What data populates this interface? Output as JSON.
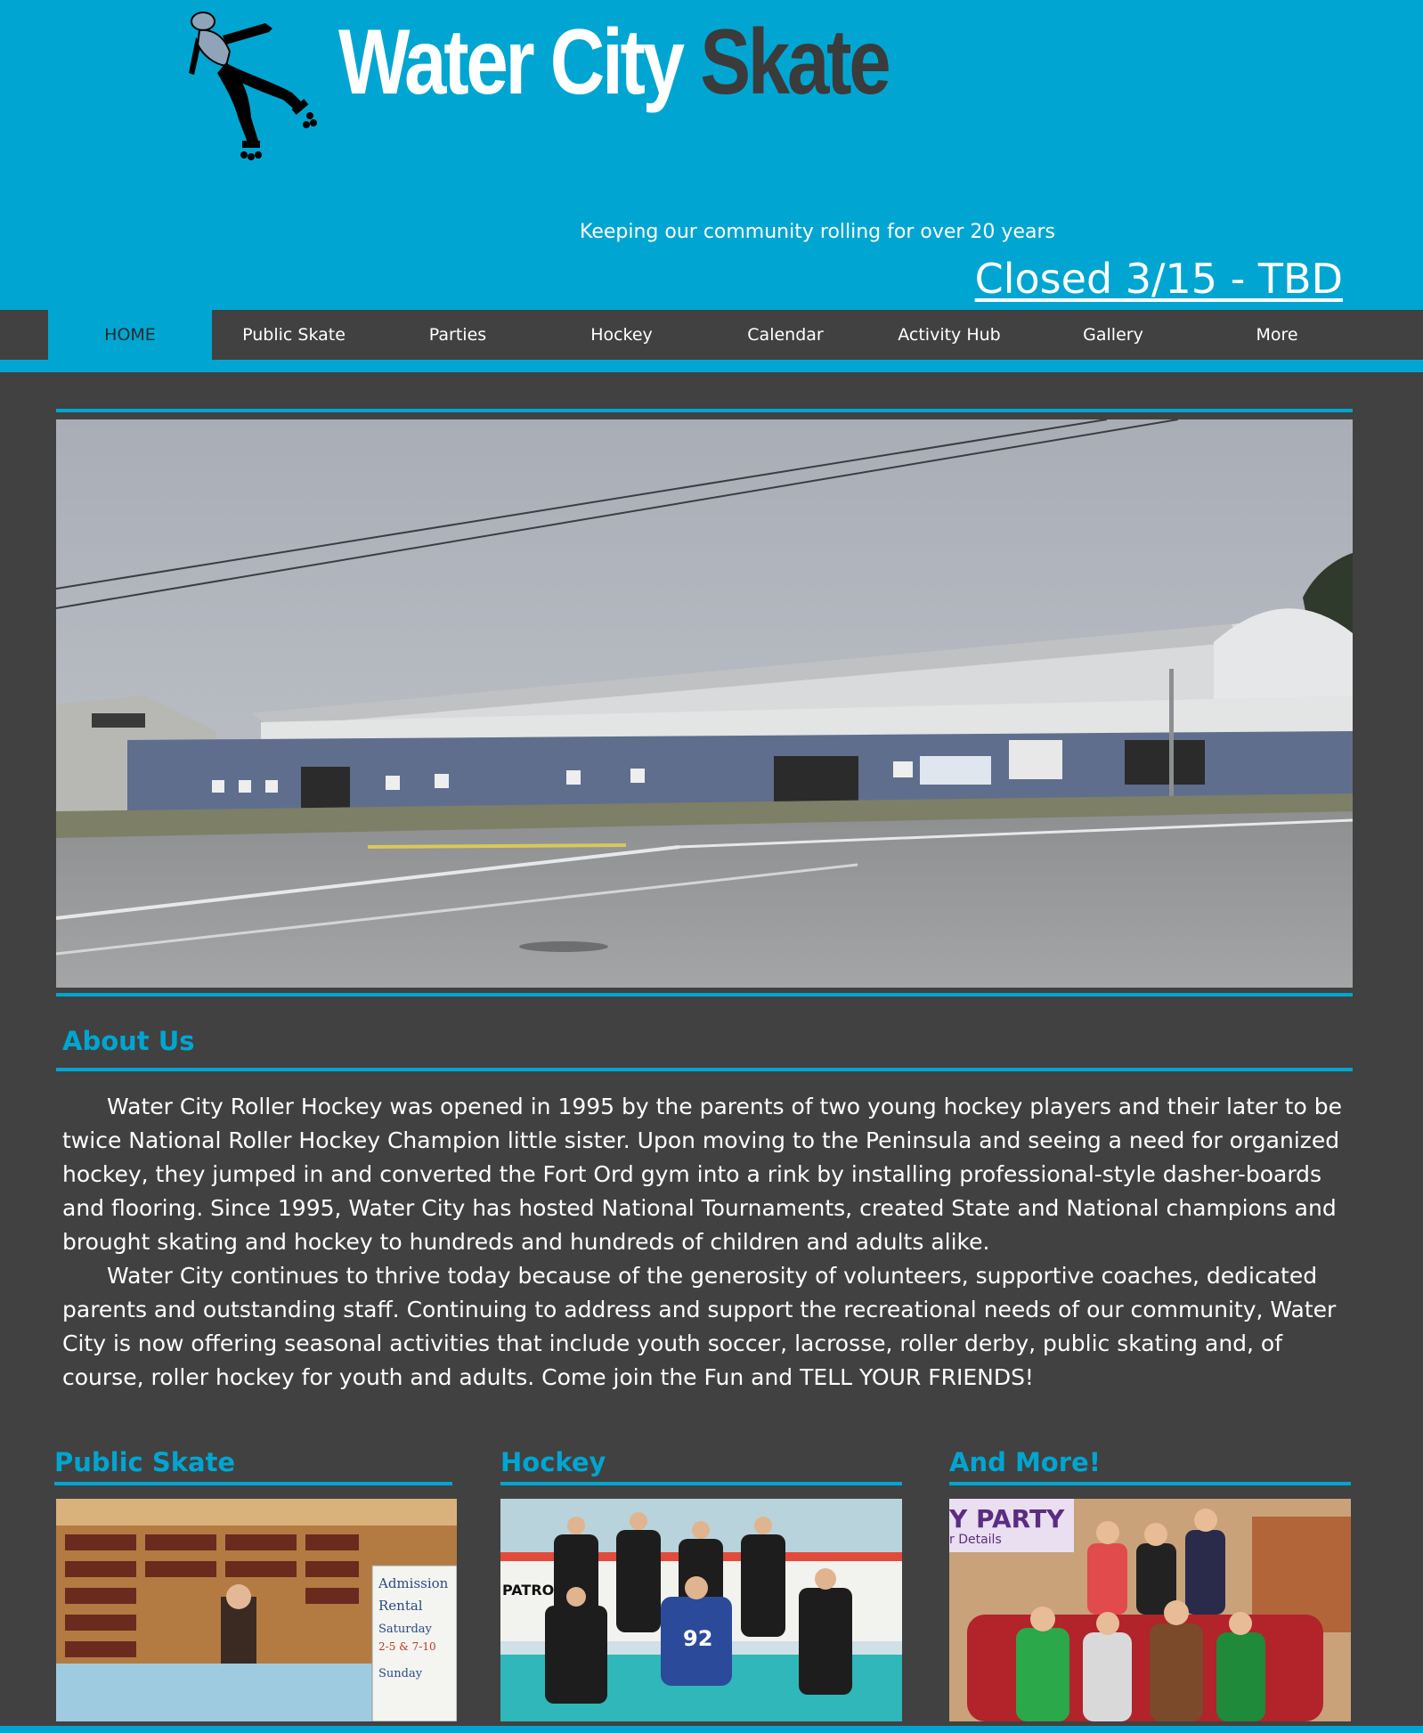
{
  "site": {
    "title_part1": "Water City",
    "title_part2": "Skate",
    "tagline": "Keeping our community rolling for over 20 years",
    "notice": "Closed 3/15 - TBD"
  },
  "nav": {
    "items": [
      "HOME",
      "Public Skate",
      "Parties",
      "Hockey",
      "Calendar",
      "Activity Hub",
      "Gallery",
      "More"
    ],
    "active": "HOME"
  },
  "about": {
    "heading": "About Us",
    "paragraphs": [
      "Water City Roller Hockey was opened in 1995 by the parents of two young hockey players and their later to be twice National Roller Hockey Champion little sister. Upon moving to the Peninsula and seeing a need for organized hockey, they jumped in and converted the Fort Ord gym into a rink by installing professional-style dasher-boards and flooring. Since 1995, Water City has hosted National Tournaments, created State and National champions and brought skating and hockey to hundreds and hundreds of children and adults alike.",
      "Water City continues to thrive today because of the generosity of volunteers, supportive coaches, dedicated parents and outstanding staff. Continuing to address and support the recreational needs of our community, Water City  is now offering seasonal activities that include youth soccer, lacrosse, roller derby, public skating and, of course, roller hockey for youth and adults. Come join the Fun and TELL YOUR FRIENDS!"
    ]
  },
  "cards": [
    {
      "title": "Public Skate",
      "sign_line1": "Admission",
      "sign_line2": "Rental",
      "sign_line3": "Saturday",
      "sign_line4": "2-5 & 7-10",
      "sign_line5": "Sunday"
    },
    {
      "title": "Hockey",
      "jersey_number": "92",
      "board_text": "PATROL"
    },
    {
      "title": "And More!",
      "banner_text": "Y PARTY",
      "banner_sub": "r Details"
    }
  ],
  "colors": {
    "accent": "#00a6d1",
    "background": "#414141",
    "logo_dark": "#3b3b3b"
  }
}
